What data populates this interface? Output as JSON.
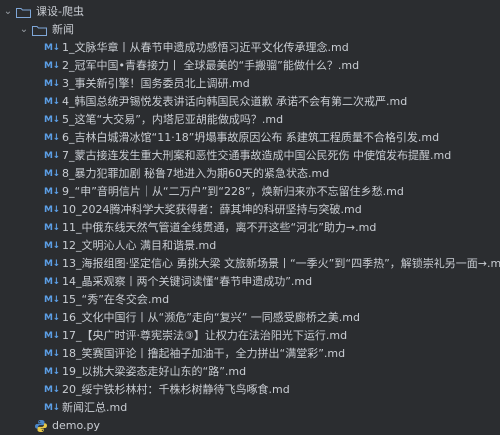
{
  "tree": {
    "root": {
      "label": "课设-爬虫",
      "expanded": true
    },
    "news_folder": {
      "label": "新闻",
      "expanded": true
    },
    "md_badge": "M↓",
    "files": [
      "1_文脉华章丨从春节申遗成功感悟习近平文化传承理念.md",
      "2_冠军中国•青春接力丨 全球最美的“手搬骝”能做什么？.md",
      "3_事关新引擎！国务委员北上调研.md",
      "4_韩国总统尹锡悦发表讲话向韩国民众道歉 承诺不会有第二次戒严.md",
      "5_这笔“大交易”，内塔尼亚胡能做成吗？.md",
      "6_吉林白城滑冰馆“11·18”坍塌事故原因公布 系建筑工程质量不合格引发.md",
      "7_蒙古接连发生重大刑案和恶性交通事故造成中国公民死伤 中使馆发布提醒.md",
      "8_暴力犯罪加剧 秘鲁7地进入为期60天的紧急状态.md",
      "9_“申”音明信片｜从“二万户”到“228”，焕新归来亦不忘留住乡愁.md",
      "10_2024腾冲科学大奖获得者：薛其坤的科研坚持与突破.md",
      "11_中俄东线天然气管道全线贯通，离不开这些“河北”助力→.md",
      "12_文明沁人心 满目和谐景.md",
      "13_海报组图·坚定信心 勇挑大梁 文旅新场景丨“一季火”到“四季热”，解锁崇礼另一面→.md",
      "14_晶采观察丨两个关键词读懂“春节申遗成功”.md",
      "15_“秀”在冬交会.md",
      "16_文化中国行丨从“濒危”走向“复兴” 一同感受廊桥之美.md",
      "17_【央广时评·尊宪崇法③】让权力在法治阳光下运行.md",
      "18_笑赛国评论丨撸起袖子加油干，全力拼出“满堂彩”.md",
      "19_以挑大梁姿态走好山东的“路”.md",
      "20_绥宁铁杉林村：千株杉树静待飞鸟啄食.md",
      "新闻汇总.md"
    ],
    "py_file": "demo.py"
  },
  "colors": {
    "background": "#2b2d30",
    "text": "#c9cdd3",
    "md_badge": "#5c9fe6",
    "folder": "#7fa7d8",
    "chevron": "#9aa0a6"
  }
}
